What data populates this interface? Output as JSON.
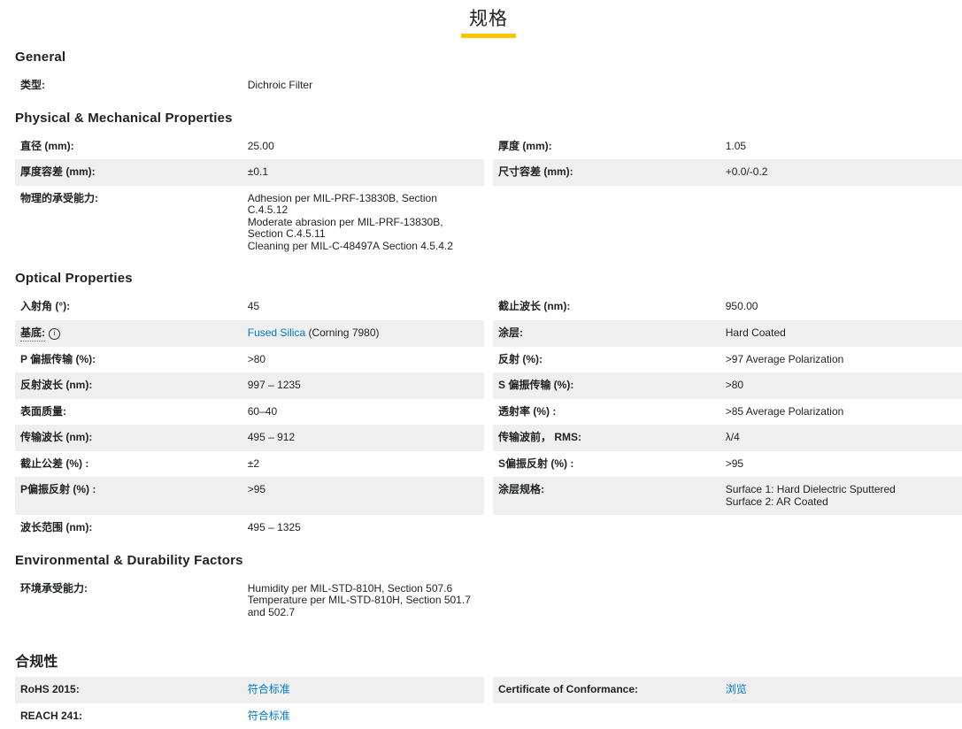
{
  "page": {
    "title": "规格"
  },
  "colors": {
    "accent_yellow": "#ffc600",
    "link_blue": "#0077c8",
    "row_shade_gray": "#efefef",
    "text_dark": "#1f2121"
  },
  "sections": [
    {
      "id": "general",
      "title": "General",
      "cjk": false,
      "rows": [
        {
          "shaded": false,
          "cells": [
            {
              "label": "类型:",
              "value": "Dichroic Filter"
            },
            null
          ]
        }
      ]
    },
    {
      "id": "physical-mechanical",
      "title": "Physical & Mechanical Properties",
      "cjk": false,
      "rows": [
        {
          "shaded": false,
          "cells": [
            {
              "label": "直径 (mm):",
              "value": "25.00"
            },
            {
              "label": "厚度 (mm):",
              "value": "1.05"
            }
          ]
        },
        {
          "shaded": true,
          "cells": [
            {
              "label": "厚度容差 (mm):",
              "value": "±0.1"
            },
            {
              "label": "尺寸容差 (mm):",
              "value": "+0.0/-0.2"
            }
          ]
        },
        {
          "shaded": false,
          "cells": [
            {
              "label": "物理的承受能力:",
              "value_lines": [
                "Adhesion per MIL-PRF-13830B, Section C.4.5.12",
                "Moderate abrasion per MIL-PRF-13830B, Section C.4.5.11",
                "Cleaning per MIL-C-48497A Section 4.5.4.2"
              ]
            },
            null
          ]
        }
      ]
    },
    {
      "id": "optical",
      "title": "Optical Properties",
      "cjk": false,
      "rows": [
        {
          "shaded": false,
          "cells": [
            {
              "label": "入射角 (°):",
              "value": "45"
            },
            {
              "label": "截止波长 (nm):",
              "value": "950.00"
            }
          ]
        },
        {
          "shaded": true,
          "cells": [
            {
              "label": "基底:",
              "dotted": true,
              "info_icon": "i",
              "value_parts": [
                {
                  "text": "Fused Silica",
                  "link": true
                },
                {
                  "text": " (Corning 7980)",
                  "link": false
                }
              ]
            },
            {
              "label": "涂层:",
              "value": "Hard Coated"
            }
          ]
        },
        {
          "shaded": false,
          "cells": [
            {
              "label": "P 偏振传输 (%):",
              "value": ">80"
            },
            {
              "label": "反射 (%):",
              "value": ">97 Average Polarization"
            }
          ]
        },
        {
          "shaded": true,
          "cells": [
            {
              "label": "反射波长 (nm):",
              "value": "997 – 1235"
            },
            {
              "label": "S 偏振传输 (%):",
              "value": ">80"
            }
          ]
        },
        {
          "shaded": false,
          "cells": [
            {
              "label": "表面质量:",
              "value": "60–40"
            },
            {
              "label": "透射率 (%) :",
              "value": ">85 Average Polarization"
            }
          ]
        },
        {
          "shaded": true,
          "cells": [
            {
              "label": "传输波长 (nm):",
              "value": "495 – 912"
            },
            {
              "label": "传输波前， RMS:",
              "value": "λ/4"
            }
          ]
        },
        {
          "shaded": false,
          "cells": [
            {
              "label": "截止公差 (%) :",
              "value": "±2"
            },
            {
              "label": "S偏振反射 (%) :",
              "value": ">95"
            }
          ]
        },
        {
          "shaded": true,
          "cells": [
            {
              "label": "P偏振反射 (%) :",
              "value": ">95"
            },
            {
              "label": "涂层规格:",
              "value_lines": [
                "Surface 1: Hard Dielectric Sputtered",
                "Surface 2: AR Coated"
              ]
            }
          ]
        },
        {
          "shaded": false,
          "cells": [
            {
              "label": "波长范围 (nm):",
              "value": "495 – 1325"
            },
            null
          ]
        }
      ]
    },
    {
      "id": "environmental-durability",
      "title": "Environmental & Durability Factors",
      "cjk": false,
      "rows": [
        {
          "shaded": false,
          "extra_bottom": true,
          "cells": [
            {
              "label": "环境承受能力:",
              "value_lines": [
                "Humidity per MIL-STD-810H, Section 507.6",
                "Temperature per MIL-STD-810H, Section 501.7 and 502.7"
              ]
            },
            null
          ]
        }
      ]
    },
    {
      "id": "compliance",
      "title": "合规性",
      "cjk": true,
      "rows": [
        {
          "shaded": true,
          "cells": [
            {
              "label": "RoHS 2015:",
              "value": "符合标准",
              "value_link": true
            },
            {
              "label": "Certificate of Conformance:",
              "value": "浏览",
              "value_link": true
            }
          ]
        },
        {
          "shaded": false,
          "cells": [
            {
              "label": "REACH 241:",
              "value": "符合标准",
              "value_link": true
            },
            null
          ]
        }
      ]
    }
  ]
}
